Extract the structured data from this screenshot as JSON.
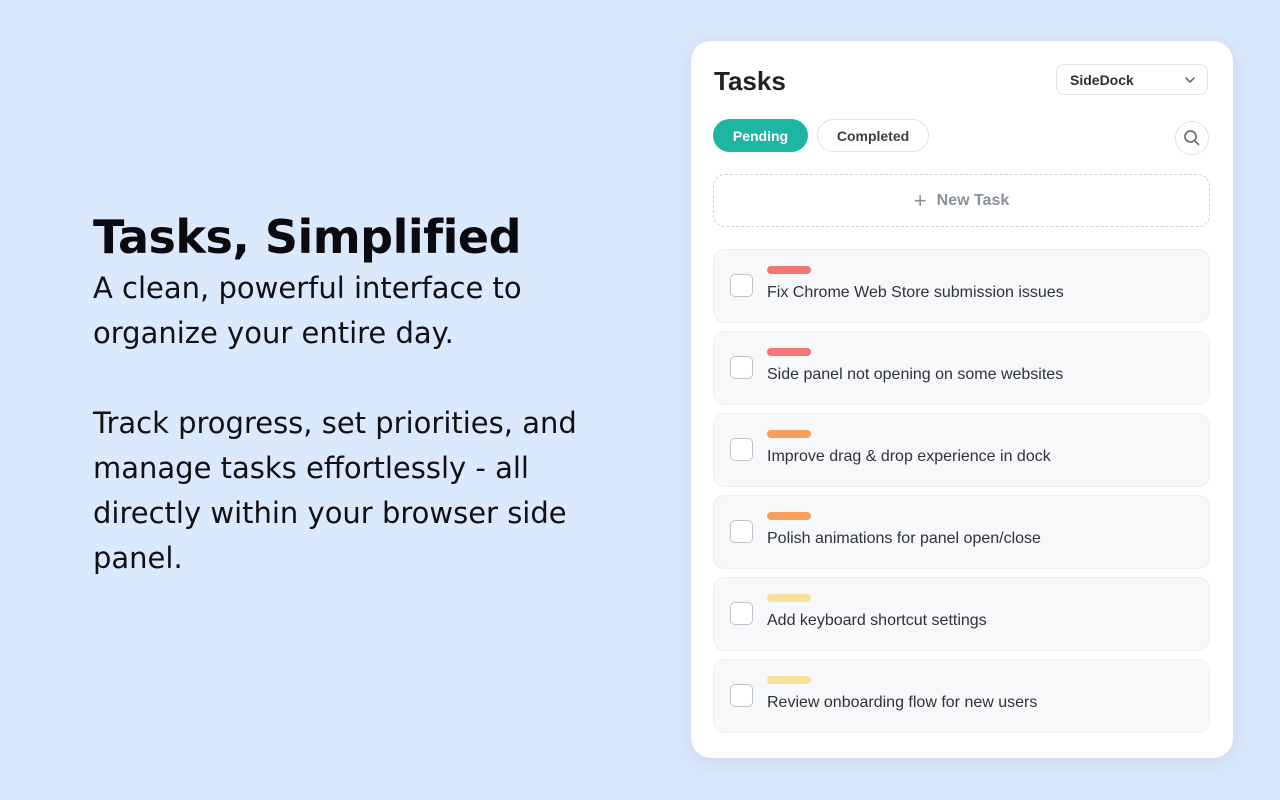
{
  "hero": {
    "title": "Tasks, Simplified",
    "line1": "A clean, powerful interface to organize your entire day.",
    "line2": "Track progress, set priorities, and manage tasks effortlessly - all directly within your browser side panel."
  },
  "panel": {
    "title": "Tasks",
    "workspace": "SideDock",
    "tabs": [
      {
        "label": "Pending",
        "active": true
      },
      {
        "label": "Completed",
        "active": false
      }
    ],
    "new_task_label": "New Task",
    "icons": {
      "search": "search-icon",
      "chevron": "chevron-down-icon",
      "plus": "plus-icon"
    }
  },
  "priority_colors": {
    "high": "#f47373",
    "medium": "#f6a05a",
    "low": "#f8e19a"
  },
  "tasks": [
    {
      "title": "Fix Chrome Web Store submission issues",
      "priority": "high"
    },
    {
      "title": "Side panel not opening on some websites",
      "priority": "high"
    },
    {
      "title": "Improve drag & drop experience in dock",
      "priority": "medium"
    },
    {
      "title": "Polish animations for panel open/close",
      "priority": "medium"
    },
    {
      "title": "Add keyboard shortcut settings",
      "priority": "low"
    },
    {
      "title": "Review onboarding flow for new users",
      "priority": "low"
    }
  ]
}
